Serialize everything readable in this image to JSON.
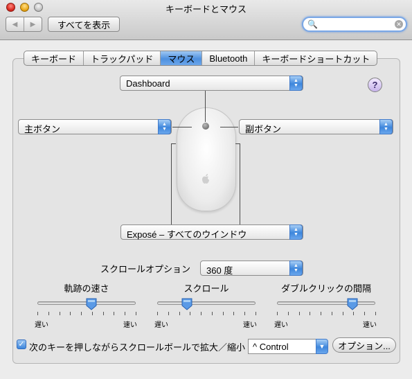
{
  "window": {
    "title": "キーボードとマウス"
  },
  "toolbar": {
    "back_label": "◀",
    "forward_label": "▶",
    "show_all_label": "すべてを表示",
    "search_value": ""
  },
  "tabs": [
    {
      "label": "キーボード",
      "active": false
    },
    {
      "label": "トラックパッド",
      "active": false
    },
    {
      "label": "マウス",
      "active": true
    },
    {
      "label": "Bluetooth",
      "active": false
    },
    {
      "label": "キーボードショートカット",
      "active": false
    }
  ],
  "mouse": {
    "top_popup": "Dashboard",
    "left_popup": "主ボタン",
    "right_popup": "副ボタン",
    "bottom_popup": "Exposé – すべてのウインドウ",
    "help_label": "?"
  },
  "scroll_option": {
    "label": "スクロールオプション",
    "value": "360 度"
  },
  "sliders": [
    {
      "label": "軌跡の速さ",
      "min_label": "遅い",
      "max_label": "速い",
      "value": 0.55
    },
    {
      "label": "スクロール",
      "min_label": "遅い",
      "max_label": "速い",
      "value": 0.3
    },
    {
      "label": "ダブルクリックの間隔",
      "min_label": "遅い",
      "max_label": "速い",
      "value": 0.77
    }
  ],
  "zoom": {
    "checkbox_checked": true,
    "checkbox_label": "次のキーを押しながらスクロールボールで拡大／縮小",
    "modifier_value": "^ Control",
    "options_button": "オプション..."
  },
  "colors": {
    "accent": "#3d86dc",
    "tab_active": "#6ba6ea"
  }
}
